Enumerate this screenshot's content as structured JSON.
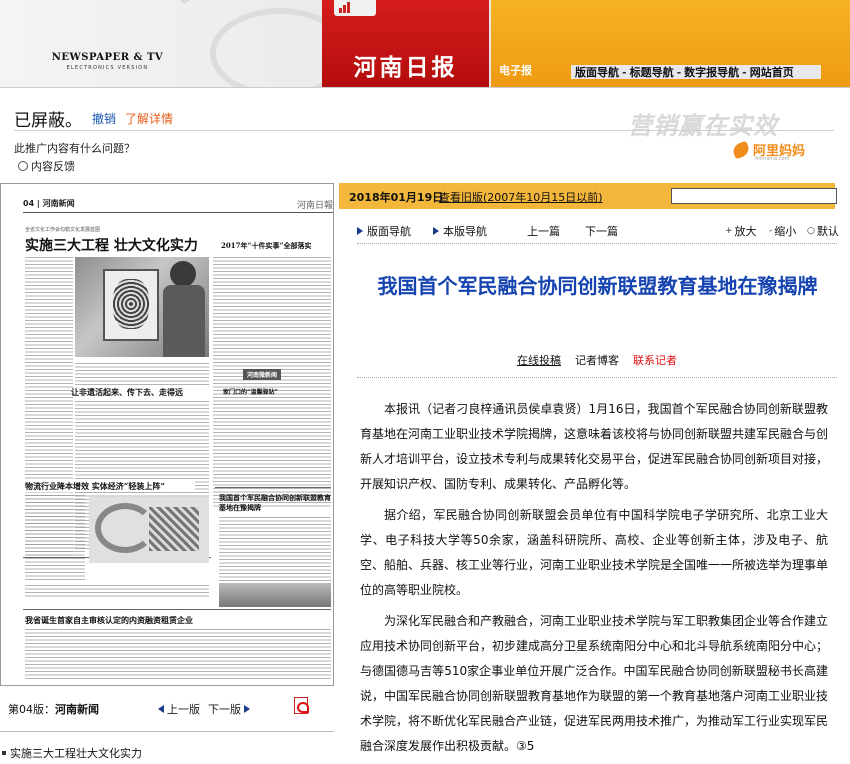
{
  "header": {
    "logo_line1": "NEWSPAPER & TV",
    "logo_line2": "ELECTRONICS VERSION",
    "brand_name": "河南日报",
    "edition_badge": "电子报",
    "top_nav": [
      "版面导航",
      "标题导航",
      "数字报导航",
      "网站首页"
    ]
  },
  "ad": {
    "blocked_text": "已屏蔽。",
    "undo_label": "撤销",
    "learn_more_label": "了解详情",
    "slogan": "营销赢在实效",
    "question": "此推广内容有什么问题？",
    "feedback_label": "内容反馈",
    "alimama_name": "阿里妈妈",
    "alimama_sub": "Alimama.com"
  },
  "newspaper": {
    "page_label": "04 | 河南新闻",
    "masthead": "河南日報",
    "headline_main": "实施三大工程 壮大文化实力",
    "subhead_main": "全省文化工作会勾勒文化发展蓝图",
    "headline_2017": "2017年“十件实事”全部落实",
    "headline_left2": "让非遗活起来、传下去、走得远",
    "headline_newsbox": "河南微新闻",
    "headline_door": "家门口的“温馨驿站”",
    "headline_logistics": "物流行业降本增效 实体经济“轻装上阵”",
    "headline_base": "我国首个军民融合协同创新联盟教育基地在豫揭牌",
    "headline_bottom": "我省诞生首家自主审核认定的内资融资租赁企业"
  },
  "left_footer": {
    "edition_prefix": "第04版：",
    "edition_name": "河南新闻",
    "prev_label": "上一版",
    "next_label": "下一版"
  },
  "bottom_link": "实施三大工程壮大文化实力",
  "article": {
    "date": "2018年01月19日",
    "old_edition_link": "查看旧版(2007年10月15日以前)",
    "toolbar": {
      "layout_nav": "版面导航",
      "this_page_nav": "本版导航",
      "prev_article": "上一篇",
      "next_article": "下一篇",
      "zoom_in": "放大",
      "zoom_out": "缩小",
      "default": "默认"
    },
    "title": "我国首个军民融合协同创新联盟教育基地在豫揭牌",
    "byline": {
      "online_submit": "在线投稿",
      "reporter": "记者博客",
      "contact": "联系记者"
    },
    "paragraphs": [
      "本报讯（记者刁良梓通讯员侯卓袁贤）1月16日，我国首个军民融合协同创新联盟教育基地在河南工业职业技术学院揭牌，这意味着该校将与协同创新联盟共建军民融合与创新人才培训平台，设立技术专利与成果转化交易平台，促进军民融合协同创新项目对接，开展知识产权、国防专利、成果转化、产品孵化等。",
      "据介绍，军民融合协同创新联盟会员单位有中国科学院电子学研究所、北京工业大学、电子科技大学等50余家，涵盖科研院所、高校、企业等创新主体，涉及电子、航空、船舶、兵器、核工业等行业，河南工业职业技术学院是全国唯一一所被选举为理事单位的高等职业院校。",
      "为深化军民融合和产教融合，河南工业职业技术学院与军工职教集团企业等合作建立应用技术协同创新平台，初步建成高分卫星系统南阳分中心和北斗导航系统南阳分中心；与德国德马吉等510家企事业单位开展广泛合作。中国军民融合协同创新联盟秘书长高建说，中国军民融合协同创新联盟教育基地作为联盟的第一个教育基地落户河南工业职业技术学院，将不断优化军民融合产业链，促进军民两用技术推广，为推动军工行业实现军民融合深度发展作出积极贡献。③5"
    ]
  },
  "colors": {
    "brand_red": "#c41414",
    "orange": "#f3b73c",
    "title_blue": "#1544b0",
    "link_blue": "#1a55b3",
    "accent_orange": "#e65c1a"
  }
}
